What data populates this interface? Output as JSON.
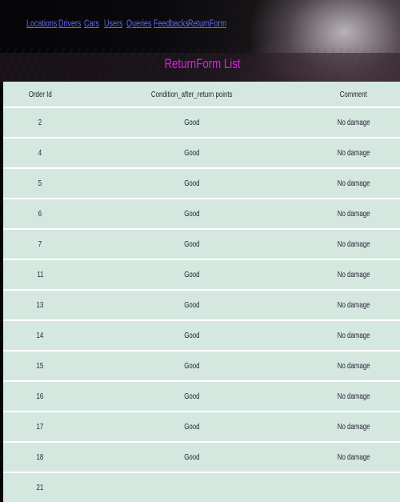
{
  "nav": {
    "links": [
      "Locations",
      "Drivers",
      "Cars",
      "Users",
      "Queries",
      "Feedbacks",
      "ReturnForm"
    ]
  },
  "page": {
    "title": "ReturnForm List"
  },
  "table": {
    "headers": [
      "Order Id",
      "Condition_after_return points",
      "Comment"
    ],
    "rows": [
      [
        "2",
        "Good",
        "No damage"
      ],
      [
        "4",
        "Good",
        "No damage"
      ],
      [
        "5",
        "Good",
        "No damage"
      ],
      [
        "6",
        "Good",
        "No damage"
      ],
      [
        "7",
        "Good",
        "No damage"
      ],
      [
        "11",
        "Good",
        "No damage"
      ],
      [
        "13",
        "Good",
        "No damage"
      ],
      [
        "14",
        "Good",
        "No damage"
      ],
      [
        "15",
        "Good",
        "No damage"
      ],
      [
        "16",
        "Good",
        "No damage"
      ],
      [
        "17",
        "Good",
        "No damage"
      ],
      [
        "18",
        "Good",
        "No damage"
      ],
      [
        "21",
        "",
        ""
      ]
    ]
  },
  "colors": {
    "link": "#5b6bff",
    "title": "#e020e0",
    "row_bg": "#d5e8e0"
  }
}
